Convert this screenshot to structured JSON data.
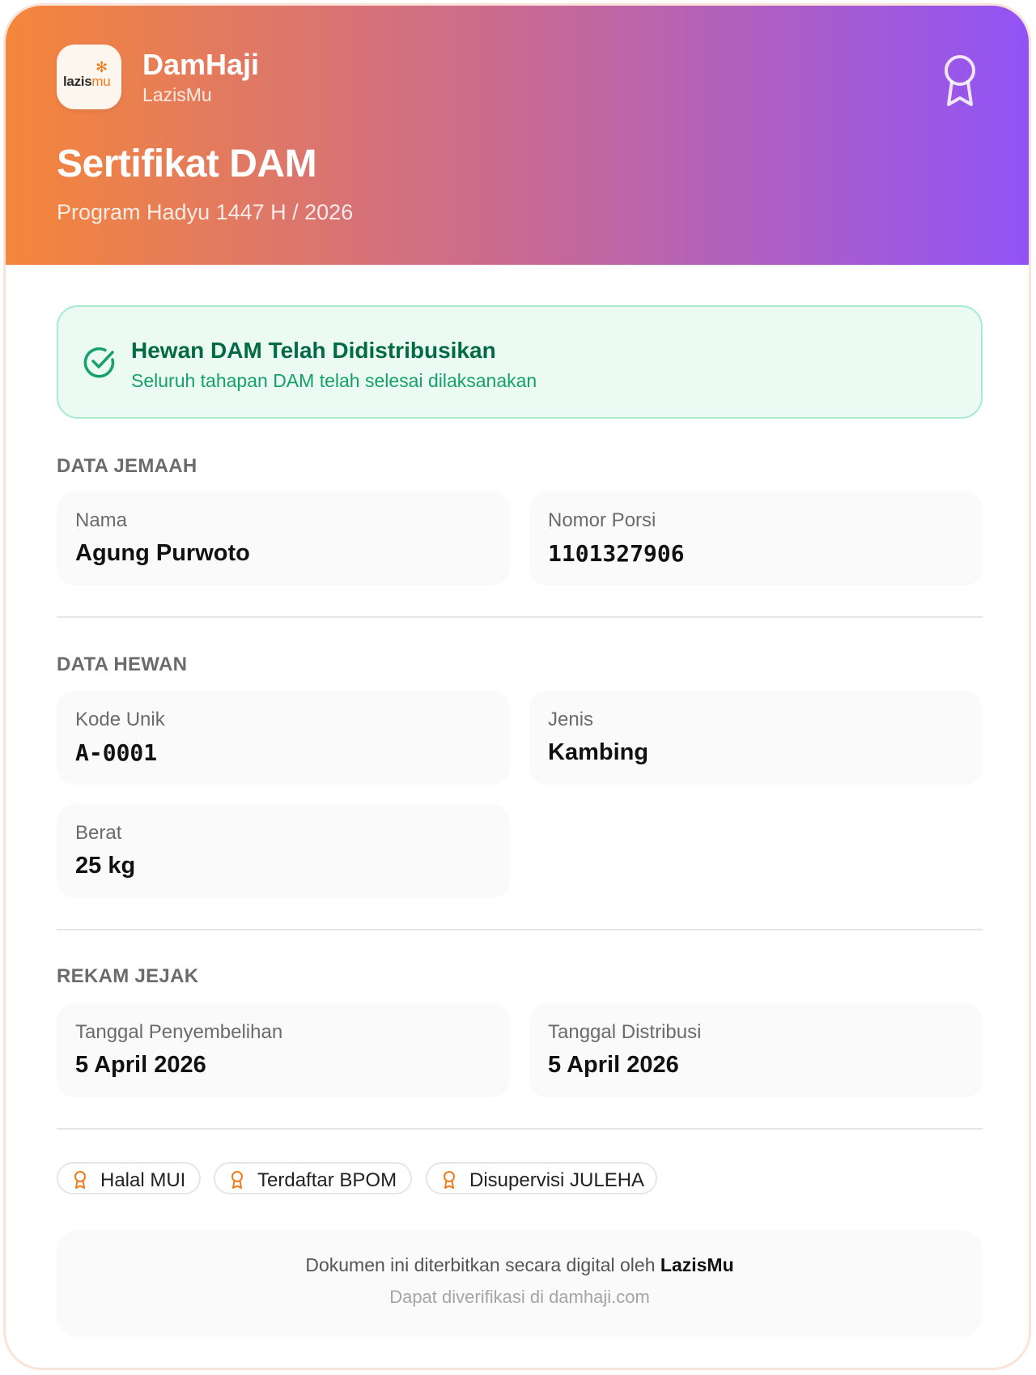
{
  "header": {
    "logo": {
      "main": "lazis",
      "accent": "mu"
    },
    "brand_name": "DamHaji",
    "brand_sub": "LazisMu",
    "title": "Sertifikat DAM",
    "subtitle": "Program Hadyu 1447 H / 2026",
    "award_icon": "award-ribbon-icon"
  },
  "status": {
    "icon": "check-circle-icon",
    "title": "Hewan DAM Telah Didistribusikan",
    "subtitle": "Seluruh tahapan DAM telah selesai dilaksanakan"
  },
  "jemaah": {
    "label": "DATA JEMAAH",
    "nama_label": "Nama",
    "nama_value": "Agung Purwoto",
    "porsi_label": "Nomor Porsi",
    "porsi_value": "1101327906"
  },
  "hewan": {
    "label": "DATA HEWAN",
    "kode_label": "Kode Unik",
    "kode_value": "A-0001",
    "jenis_label": "Jenis",
    "jenis_value": "Kambing",
    "berat_label": "Berat",
    "berat_value": "25 kg"
  },
  "rekam": {
    "label": "REKAM JEJAK",
    "sembelih_label": "Tanggal Penyembelihan",
    "sembelih_value": "5 April 2026",
    "distribusi_label": "Tanggal Distribusi",
    "distribusi_value": "5 April 2026"
  },
  "badges": [
    {
      "label": "Halal MUI",
      "icon": "award-icon"
    },
    {
      "label": "Terdaftar BPOM",
      "icon": "award-icon"
    },
    {
      "label": "Disupervisi JULEHA",
      "icon": "award-icon"
    }
  ],
  "footer": {
    "line1_prefix": "Dokumen ini diterbitkan secara digital oleh ",
    "line1_strong": "LazisMu",
    "line2": "Dapat diverifikasi di damhaji.com"
  },
  "colors": {
    "gradient_start": "#f5863a",
    "gradient_end": "#9153f6",
    "success_dark": "#036b43",
    "success": "#16a06b",
    "badge_icon": "#f27a1a"
  }
}
